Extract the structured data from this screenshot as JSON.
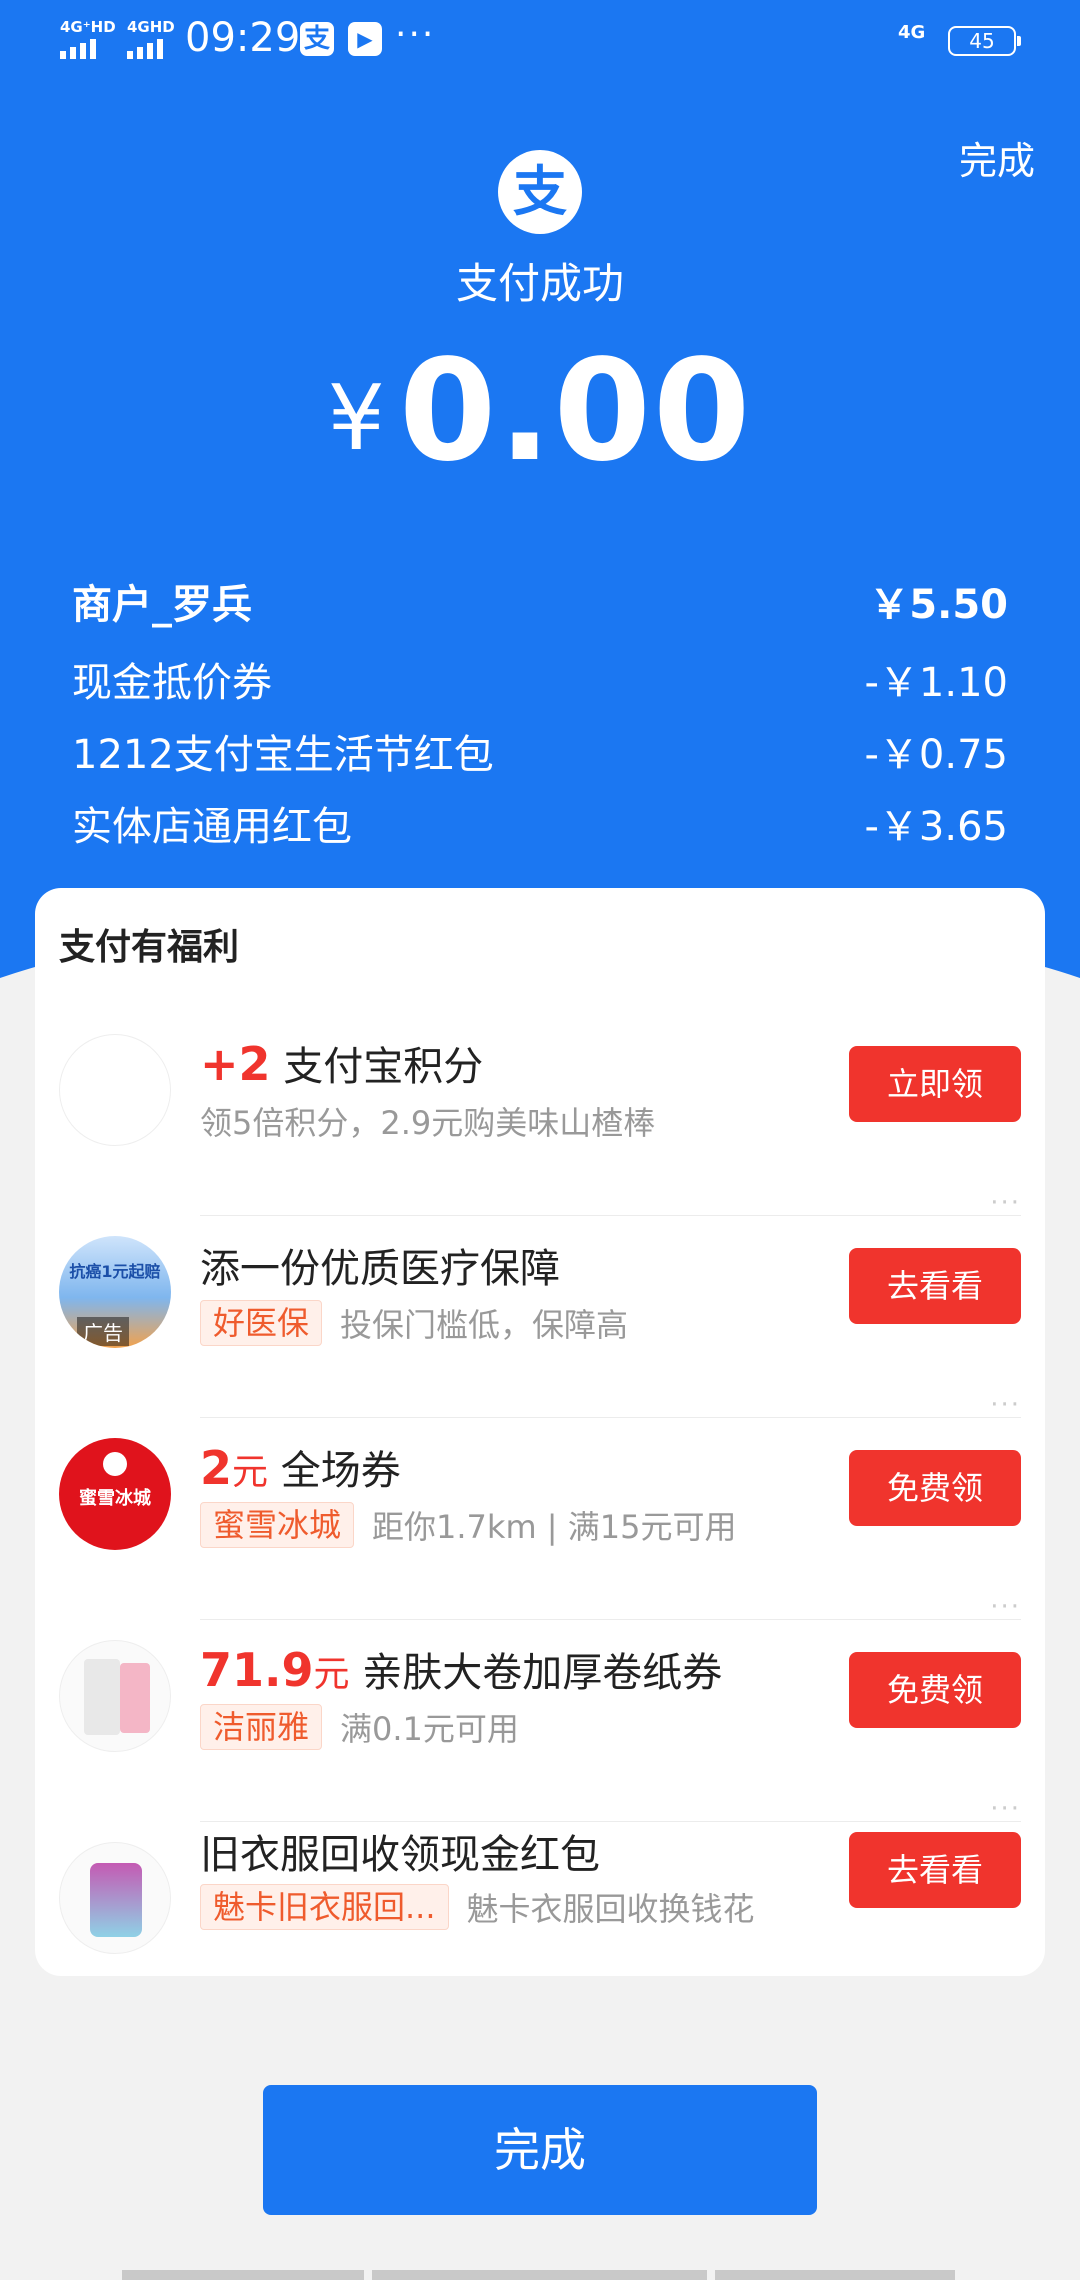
{
  "status_bar": {
    "sim1": "4G⁺HD",
    "sim2": "4GHD",
    "time": "09:29",
    "app_icon_1": "支",
    "app_icon_2": "▶",
    "more": "···",
    "net": "4G",
    "battery": "45"
  },
  "header": {
    "done_label": "完成",
    "logo_glyph": "支",
    "status": "支付成功",
    "currency": "¥",
    "amount": "0.00"
  },
  "details": [
    {
      "label": "商户_罗兵",
      "value": "￥5.50"
    },
    {
      "label": "现金抵价券",
      "value": "-￥1.10"
    },
    {
      "label": "1212支付宝生活节红包",
      "value": "-￥0.75"
    },
    {
      "label": "实体店通用红包",
      "value": "-￥3.65"
    }
  ],
  "benefits": {
    "title": "支付有福利",
    "items": [
      {
        "highlight": "+2",
        "highlight_unit": "",
        "title": "支付宝积分",
        "tag": "",
        "desc": "领5倍积分，2.9元购美味山楂棒",
        "button": "立即领"
      },
      {
        "highlight": "",
        "highlight_unit": "",
        "title": "添一份优质医疗保障",
        "tag": "好医保",
        "desc": "投保门槛低，保障高",
        "button": "去看看",
        "avatar_text": "抗癌1元起赔",
        "ad_label": "广告"
      },
      {
        "highlight": "2",
        "highlight_unit": "元",
        "title": "全场券",
        "tag": "蜜雪冰城",
        "desc": "距你1.7km  |  满15元可用",
        "button": "免费领",
        "avatar_text": "蜜雪冰城"
      },
      {
        "highlight": "71.9",
        "highlight_unit": "元",
        "title": "亲肤大卷加厚卷纸券",
        "tag": "洁丽雅",
        "desc": "满0.1元可用",
        "button": "免费领"
      },
      {
        "highlight": "",
        "highlight_unit": "",
        "title": "旧衣服回收领现金红包",
        "tag": "魅卡旧衣服回...",
        "desc": "魅卡衣服回收换钱花",
        "button": "去看看"
      }
    ]
  },
  "footer": {
    "done_label": "完成"
  },
  "colors": {
    "brand_blue": "#1b77f2",
    "button_red": "#f0342d",
    "tag_orange": "#ef5b2d"
  }
}
